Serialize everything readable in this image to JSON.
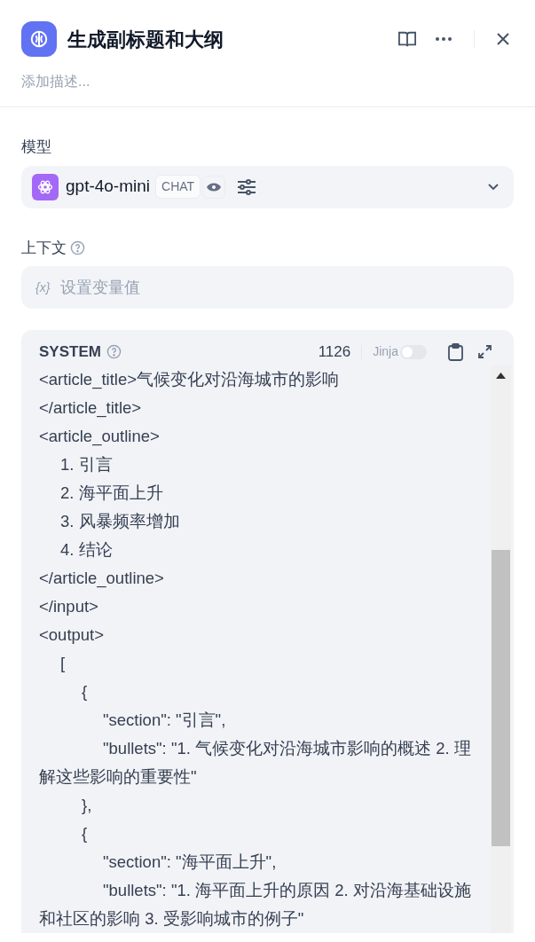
{
  "header": {
    "title": "生成副标题和大纲",
    "description_placeholder": "添加描述..."
  },
  "model": {
    "label": "模型",
    "name": "gpt-4o-mini",
    "mode": "CHAT"
  },
  "context": {
    "label": "上下文",
    "variable_mark": "{x}",
    "placeholder": "设置变量值"
  },
  "prompt": {
    "role": "SYSTEM",
    "char_count": "1126",
    "jinja": {
      "label": "Jinja",
      "on": false
    },
    "lines": [
      "<article_title>气候变化对沿海城市的影响",
      "</article_title>",
      "<article_outline>",
      "\t1. 引言",
      "\t2. 海平面上升",
      "\t3. 风暴频率增加",
      "\t4. 结论",
      "</article_outline>",
      "</input>",
      "<output>",
      "\t[",
      "\t\t{",
      "\t\t\t\"section\": \"引言\",",
      "\t\t\t\"bullets\": \"1. 气候变化对沿海城市影响的概述 2. 理解这些影响的重要性\"",
      "\t\t},",
      "\t\t{",
      "\t\t\t\"section\": \"海平面上升\",",
      "\t\t\t\"bullets\": \"1. 海平面上升的原因 2. 对沿海基础设施和社区的影响 3. 受影响城市的例子\""
    ]
  }
}
